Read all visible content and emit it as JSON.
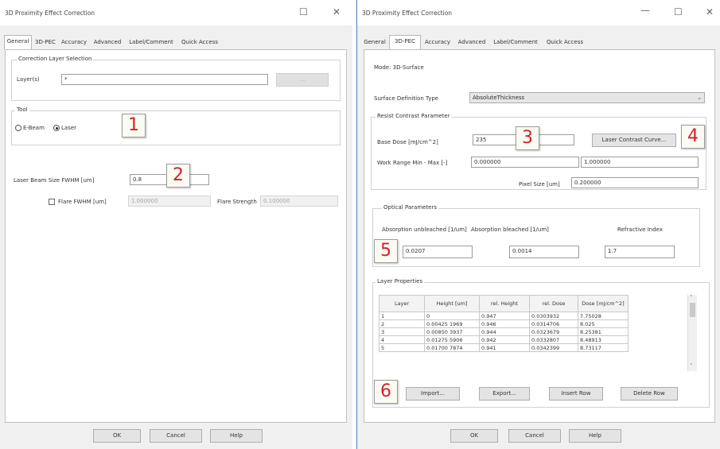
{
  "left": {
    "title": "3D Proximity Effect Correction",
    "window_controls": {
      "maximize": "☐",
      "close": "✕"
    },
    "tabs": [
      "General",
      "3D-PEC",
      "Accuracy",
      "Advanced",
      "Label/Comment",
      "Quick Access"
    ],
    "correction_group": "Correction Layer Selection",
    "layers_label": "Layer(s)",
    "layers_value": "*",
    "browse_label": "...",
    "tool_group": "Tool",
    "ebeam_label": "E-Beam",
    "laser_label": "Laser",
    "beam_size_label": "Laser Beam Size FWHM [um]",
    "beam_size_value": "0.8",
    "flare_fwhm_label": "Flare FWHM [um]",
    "flare_fwhm_value": "1.000000",
    "flare_strength_label": "Flare Strength",
    "flare_strength_value": "0.100000",
    "ok": "OK",
    "cancel": "Cancel",
    "help": "Help"
  },
  "right": {
    "title": "3D Proximity Effect Correction",
    "window_controls": {
      "minimize": "—",
      "maximize": "☐",
      "close": "✕"
    },
    "tabs": [
      "General",
      "3D-PEC",
      "Accuracy",
      "Advanced",
      "Label/Comment",
      "Quick Access"
    ],
    "mode": "Mode: 3D-Surface",
    "surface_type_label": "Surface Definition Type",
    "surface_type_value": "AbsoluteThickness",
    "resist_group": "Resist Contrast Parameter",
    "base_dose_label": "Base Dose [mJ/cm^2]",
    "base_dose_value": "235",
    "contrast_curve_button": "Laser Contrast Curve...",
    "work_range_label": "Work Range Min - Max [-]",
    "work_range_min": "0.000000",
    "work_range_max": "1.000000",
    "pixel_size_label": "Pixel Size [um]",
    "pixel_size_value": "0.200000",
    "optical_group": "Optical Parameters",
    "absorption_unbleached_label": "Absorption  unbleached [1/um]",
    "absorption_bleached_label": "Absorption  bleached [1/um]",
    "refractive_label": "Refractive Index",
    "absorption_unbleached_value": "0.0207",
    "absorption_bleached_value": "0.0014",
    "refractive_value": "1.7",
    "layer_props_group": "Layer Properties",
    "columns": [
      "Layer",
      "Height [um]",
      "rel. Height",
      "rel. Dose",
      "Dose [mJ/cm^2]"
    ],
    "rows": [
      [
        "1",
        "0",
        "0.947",
        "0.0303932",
        "7.75028"
      ],
      [
        "2",
        "0.00425 1969",
        "0.946",
        "0.0314706",
        "8.025"
      ],
      [
        "3",
        "0.00850 3937",
        "0.944",
        "0.0323679",
        "8.25381"
      ],
      [
        "4",
        "0.01275 5906",
        "0.942",
        "0.0332807",
        "8.48913"
      ],
      [
        "5",
        "0.01700 7874",
        "0.941",
        "0.0342399",
        "8.73117"
      ]
    ],
    "import": "Import...",
    "export": "Export...",
    "insert_row": "Insert Row",
    "delete_row": "Delete Row",
    "ok": "OK",
    "cancel": "Cancel",
    "help": "Help"
  },
  "badges": [
    "1",
    "2",
    "3",
    "4",
    "5",
    "6"
  ],
  "colors": {
    "badge_text": "#d2232a",
    "dialog_bg": "#f0f0f0",
    "panel_bg": "#ffffff"
  }
}
